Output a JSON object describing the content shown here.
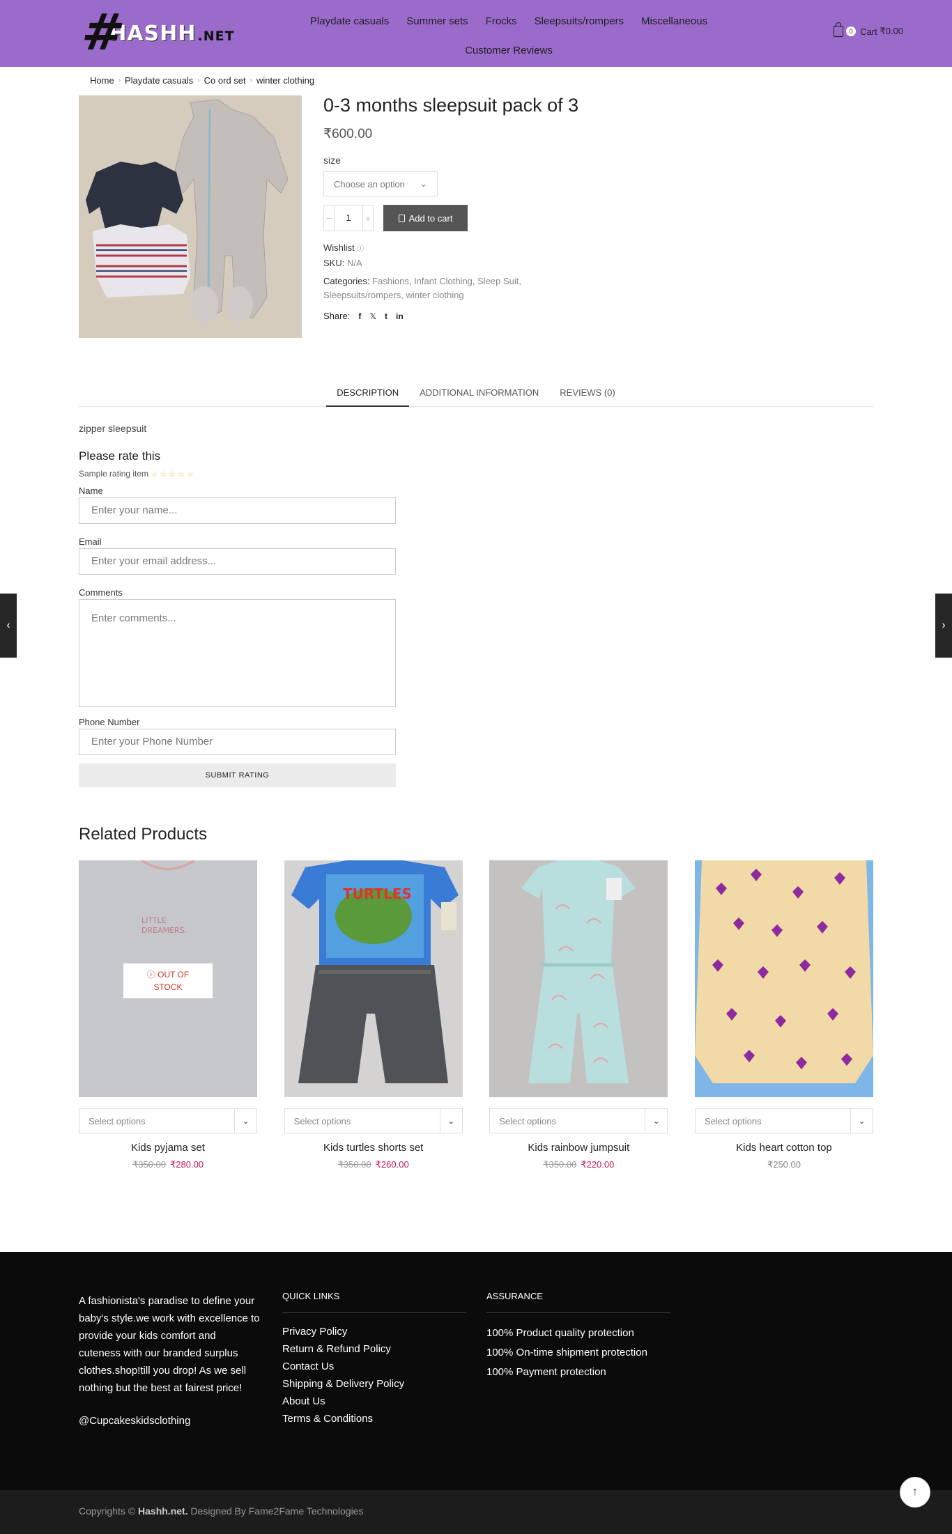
{
  "header": {
    "logo_hash": "#",
    "logo_text": "HASHH",
    "logo_net": ".NET",
    "nav": [
      "Playdate casuals",
      "Summer sets",
      "Frocks",
      "Sleepsuits/rompers",
      "Miscellaneous",
      "Customer Reviews"
    ],
    "cart_count": "0",
    "cart_label": "Cart",
    "cart_total": "₹0.00"
  },
  "breadcrumb": [
    "Home",
    "Playdate casuals",
    "Co ord set",
    "winter clothing"
  ],
  "product": {
    "title": "0-3 months sleepsuit pack of 3",
    "price": "₹600.00",
    "size_label": "size",
    "size_placeholder": "Choose an option",
    "qty": "1",
    "add_to_cart": "Add to cart",
    "wishlist": "Wishlist",
    "sku_label": "SKU:",
    "sku_value": "N/A",
    "categories_label": "Categories:",
    "categories_line1": "Fashions, Infant Clothing, Sleep Suit,",
    "categories_line2": "Sleepsuits/rompers, winter clothing",
    "share_label": "Share:",
    "share_icons": [
      "f",
      "𝕏",
      "t",
      "in"
    ]
  },
  "tabs": [
    "DESCRIPTION",
    "ADDITIONAL INFORMATION",
    "REVIEWS (0)"
  ],
  "description": "zipper sleepsuit",
  "rating_form": {
    "heading": "Please rate this",
    "sample": "Sample rating item",
    "stars": "☆☆☆☆☆",
    "name_label": "Name",
    "name_placeholder": "Enter your name...",
    "email_label": "Email",
    "email_placeholder": "Enter your email address...",
    "comments_label": "Comments",
    "comments_placeholder": "Enter comments...",
    "phone_label": "Phone Number",
    "phone_placeholder": "Enter your Phone Number",
    "submit": "SUBMIT RATING"
  },
  "related": {
    "title": "Related Products",
    "out_of_stock_line1": "OUT OF",
    "out_of_stock_line2": "STOCK",
    "items": [
      {
        "name": "Kids pyjama set",
        "select": "Select options",
        "old_price": "₹350.00",
        "price": "₹280.00"
      },
      {
        "name": "Kids turtles shorts set",
        "select": "Select options",
        "old_price": "₹350.00",
        "price": "₹260.00"
      },
      {
        "name": "Kids rainbow jumpsuit",
        "select": "Select options",
        "old_price": "₹350.00",
        "price": "₹220.00"
      },
      {
        "name": "Kids heart cotton top",
        "select": "Select options",
        "price": "₹250.00"
      }
    ]
  },
  "footer": {
    "about": "A fashionista's paradise to define your baby's style.we work with excellence to provide your kids comfort and cuteness with our branded surplus clothes.shop!till you drop! As we sell nothing but the best at fairest price!",
    "handle": "@Cupcakeskidsclothing",
    "quick_links_title": "QUICK LINKS",
    "quick_links": [
      "Privacy Policy",
      "Return & Refund Policy",
      "Contact Us",
      "Shipping & Delivery Policy",
      "About Us",
      "Terms & Conditions"
    ],
    "assurance_title": "ASSURANCE",
    "assurance": [
      "100% Product quality protection",
      "100% On-time shipment protection",
      "100% Payment protection"
    ],
    "copyright_prefix": "Copyrights ©",
    "copyright_brand": "Hashh.net.",
    "copyright_suffix": "Designed By Fame2Fame Technologies"
  }
}
